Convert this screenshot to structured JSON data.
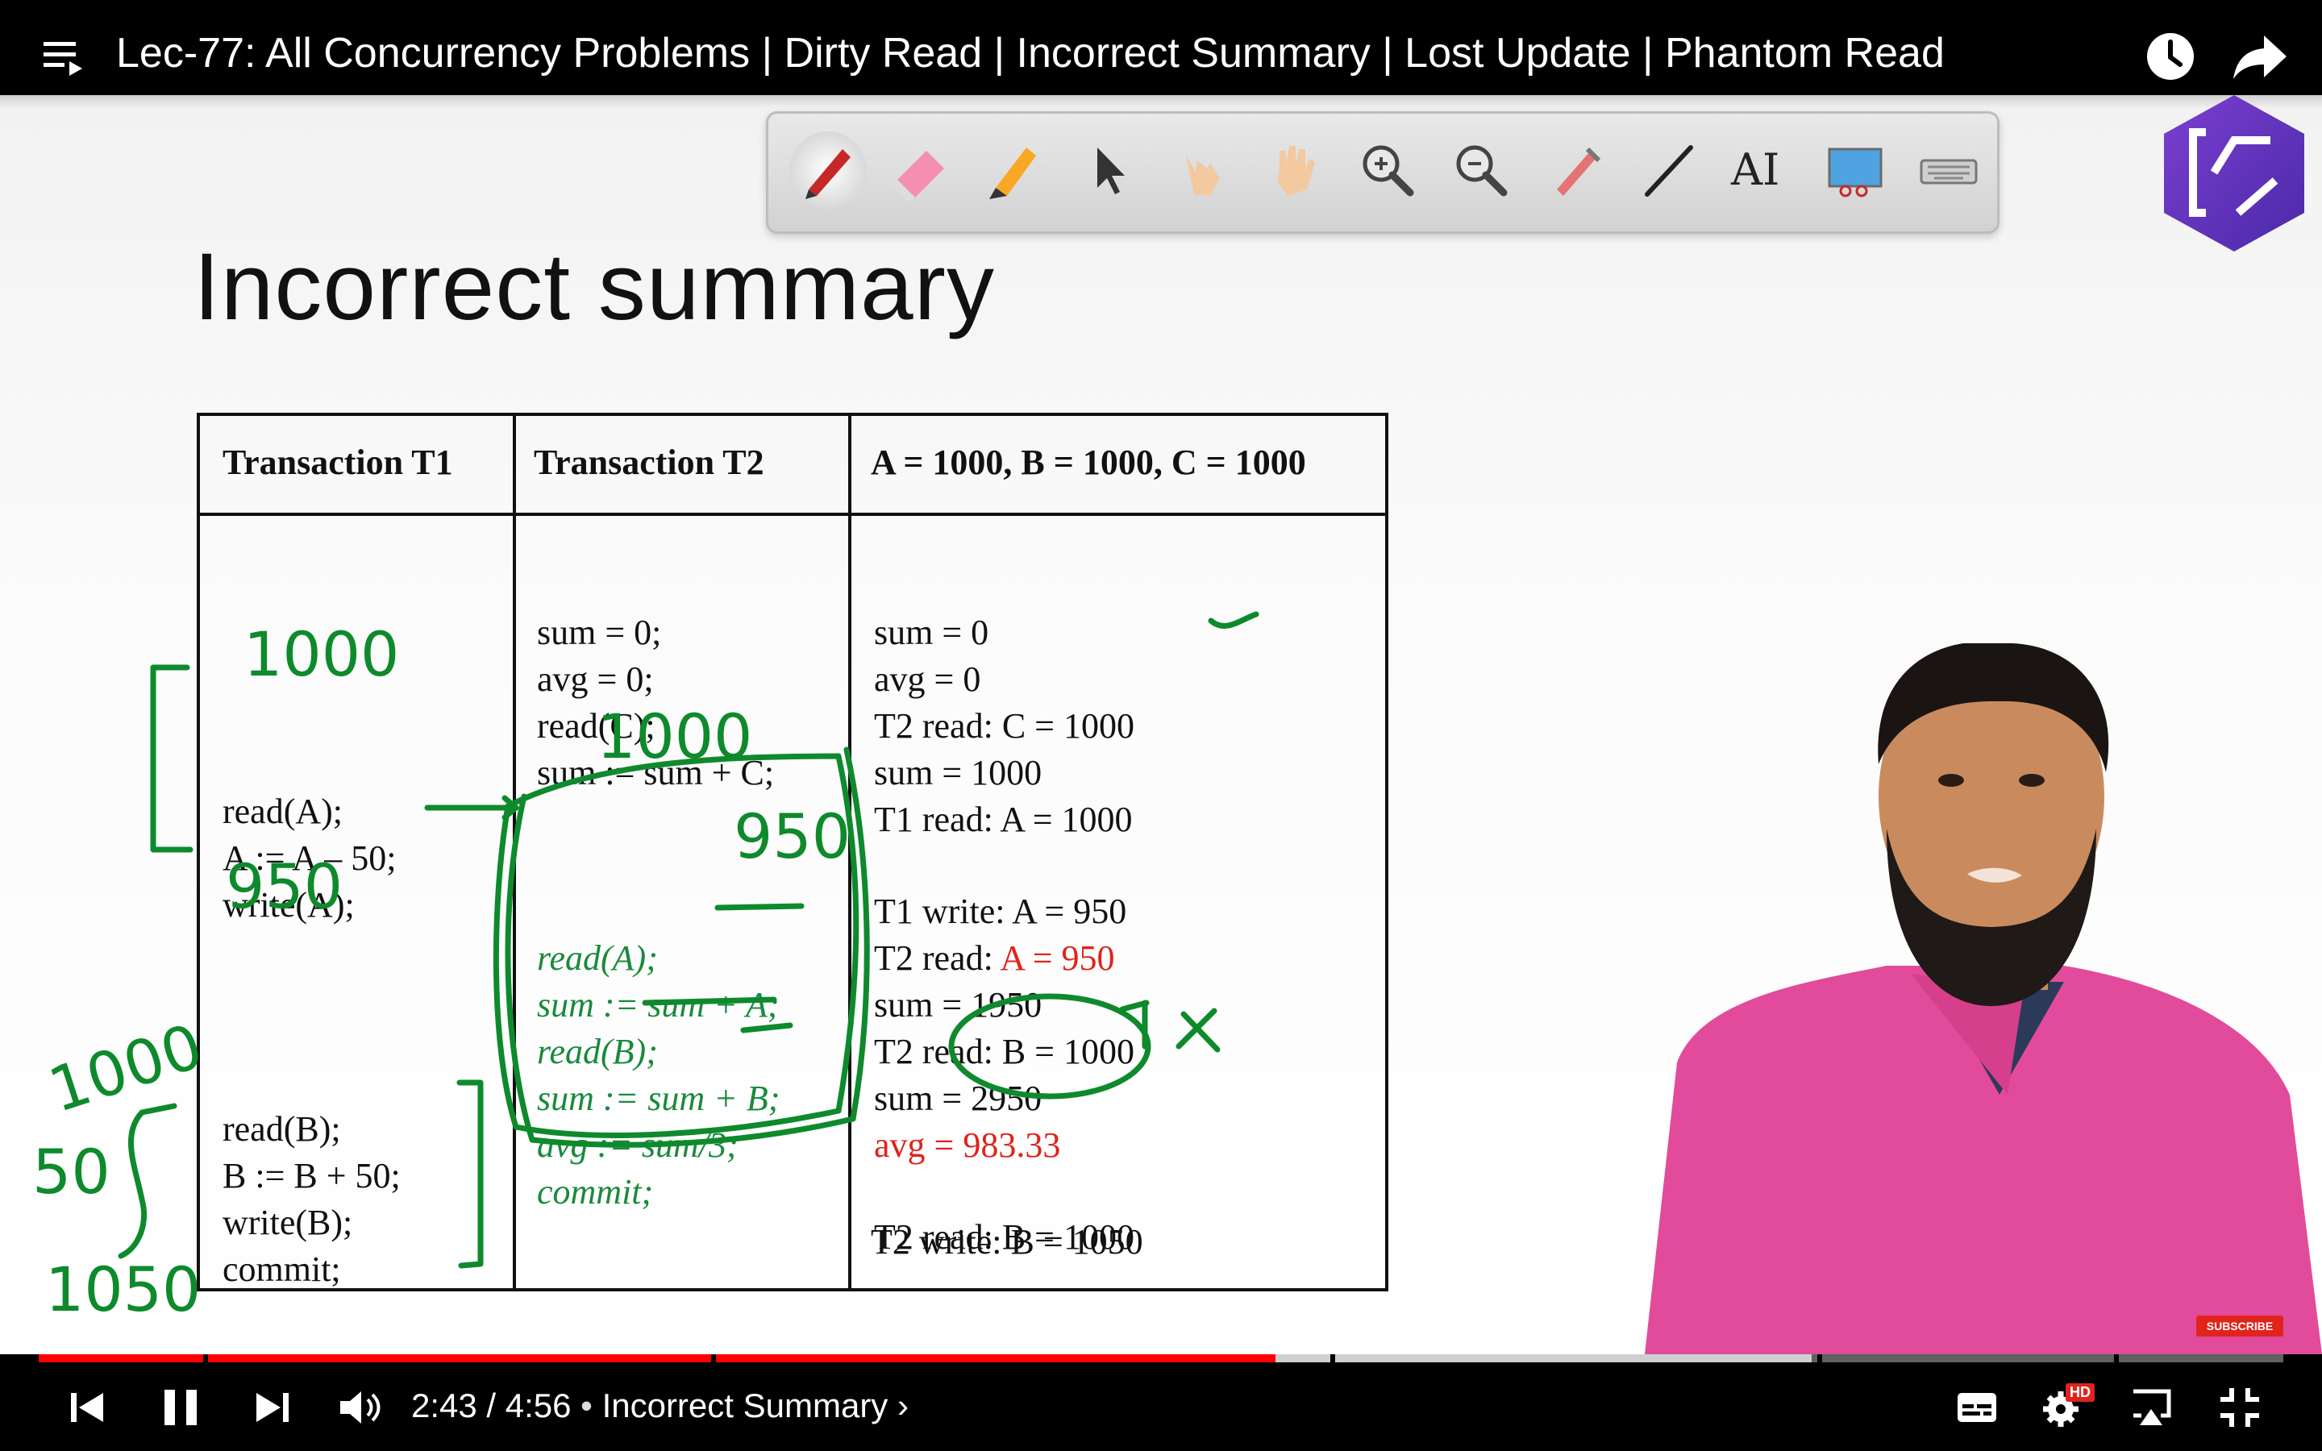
{
  "video": {
    "title": "Lec-77: All Concurrency Problems | Dirty Read | Incorrect Summary | Lost Update | Phantom Read"
  },
  "slide": {
    "title": "Incorrect summary",
    "table": {
      "headers": [
        "Transaction T1",
        "Transaction T2",
        "A = 1000, B = 1000, C = 1000"
      ],
      "t1_block1": [
        "read(A);",
        "A := A – 50;",
        "write(A);"
      ],
      "t1_block2": [
        "read(B);",
        "B := B + 50;",
        "write(B);",
        "commit;"
      ],
      "t2_block1": [
        "sum = 0;",
        "avg = 0;",
        "read(C);",
        "sum := sum + C;"
      ],
      "t2_block2": [
        "read(A);",
        "sum := sum + A;",
        "read(B);",
        "sum := sum + B;",
        "avg := sum/3;",
        "commit;"
      ],
      "state": [
        {
          "text": "sum  = 0"
        },
        {
          "text": "avg = 0"
        },
        {
          "text": "T2 read: C = 1000"
        },
        {
          "text": "sum = 1000"
        },
        {
          "text": "T1 read: A = 1000"
        },
        {
          "text": "T1 write: A = 950"
        },
        {
          "prefix": "T2 read: ",
          "highlight": "A = 950"
        },
        {
          "text": "sum = 1950"
        },
        {
          "text": "T2 read: B = 1000"
        },
        {
          "text": "sum = 2950"
        },
        {
          "prefix": "avg ",
          "highlight": "= 983.33"
        },
        {
          "text": "T2 read: B = 1000"
        },
        {
          "text": "T2 write: B = 1050"
        }
      ]
    },
    "annotations": [
      "1000",
      "950",
      "1000",
      "950",
      "1000",
      "50",
      "1050",
      "✓",
      "✗"
    ]
  },
  "player": {
    "current_time": "2:43",
    "duration": "4:56",
    "separator": " / ",
    "chapter_bullet": " • ",
    "chapter": "Incorrect Summary",
    "chapter_chevron": " ›",
    "progress_fraction": 0.551,
    "buffered_fraction": 0.79,
    "hd_badge": "HD",
    "subscribe_badge": "SUBSCRIBE"
  },
  "icons": {
    "playlist": "playlist-icon",
    "watch_later": "clock-icon",
    "share": "share-arrow-icon",
    "prev": "skip-previous-icon",
    "pause": "pause-icon",
    "next": "skip-next-icon",
    "volume": "volume-icon",
    "captions": "captions-icon",
    "settings": "gear-icon",
    "miniplayer": "airplay-icon",
    "fullscreen": "exit-fullscreen-icon"
  },
  "colors": {
    "progress": "#ff0000",
    "ink": "#0e8a2c",
    "highlight_red": "#e0231b"
  }
}
